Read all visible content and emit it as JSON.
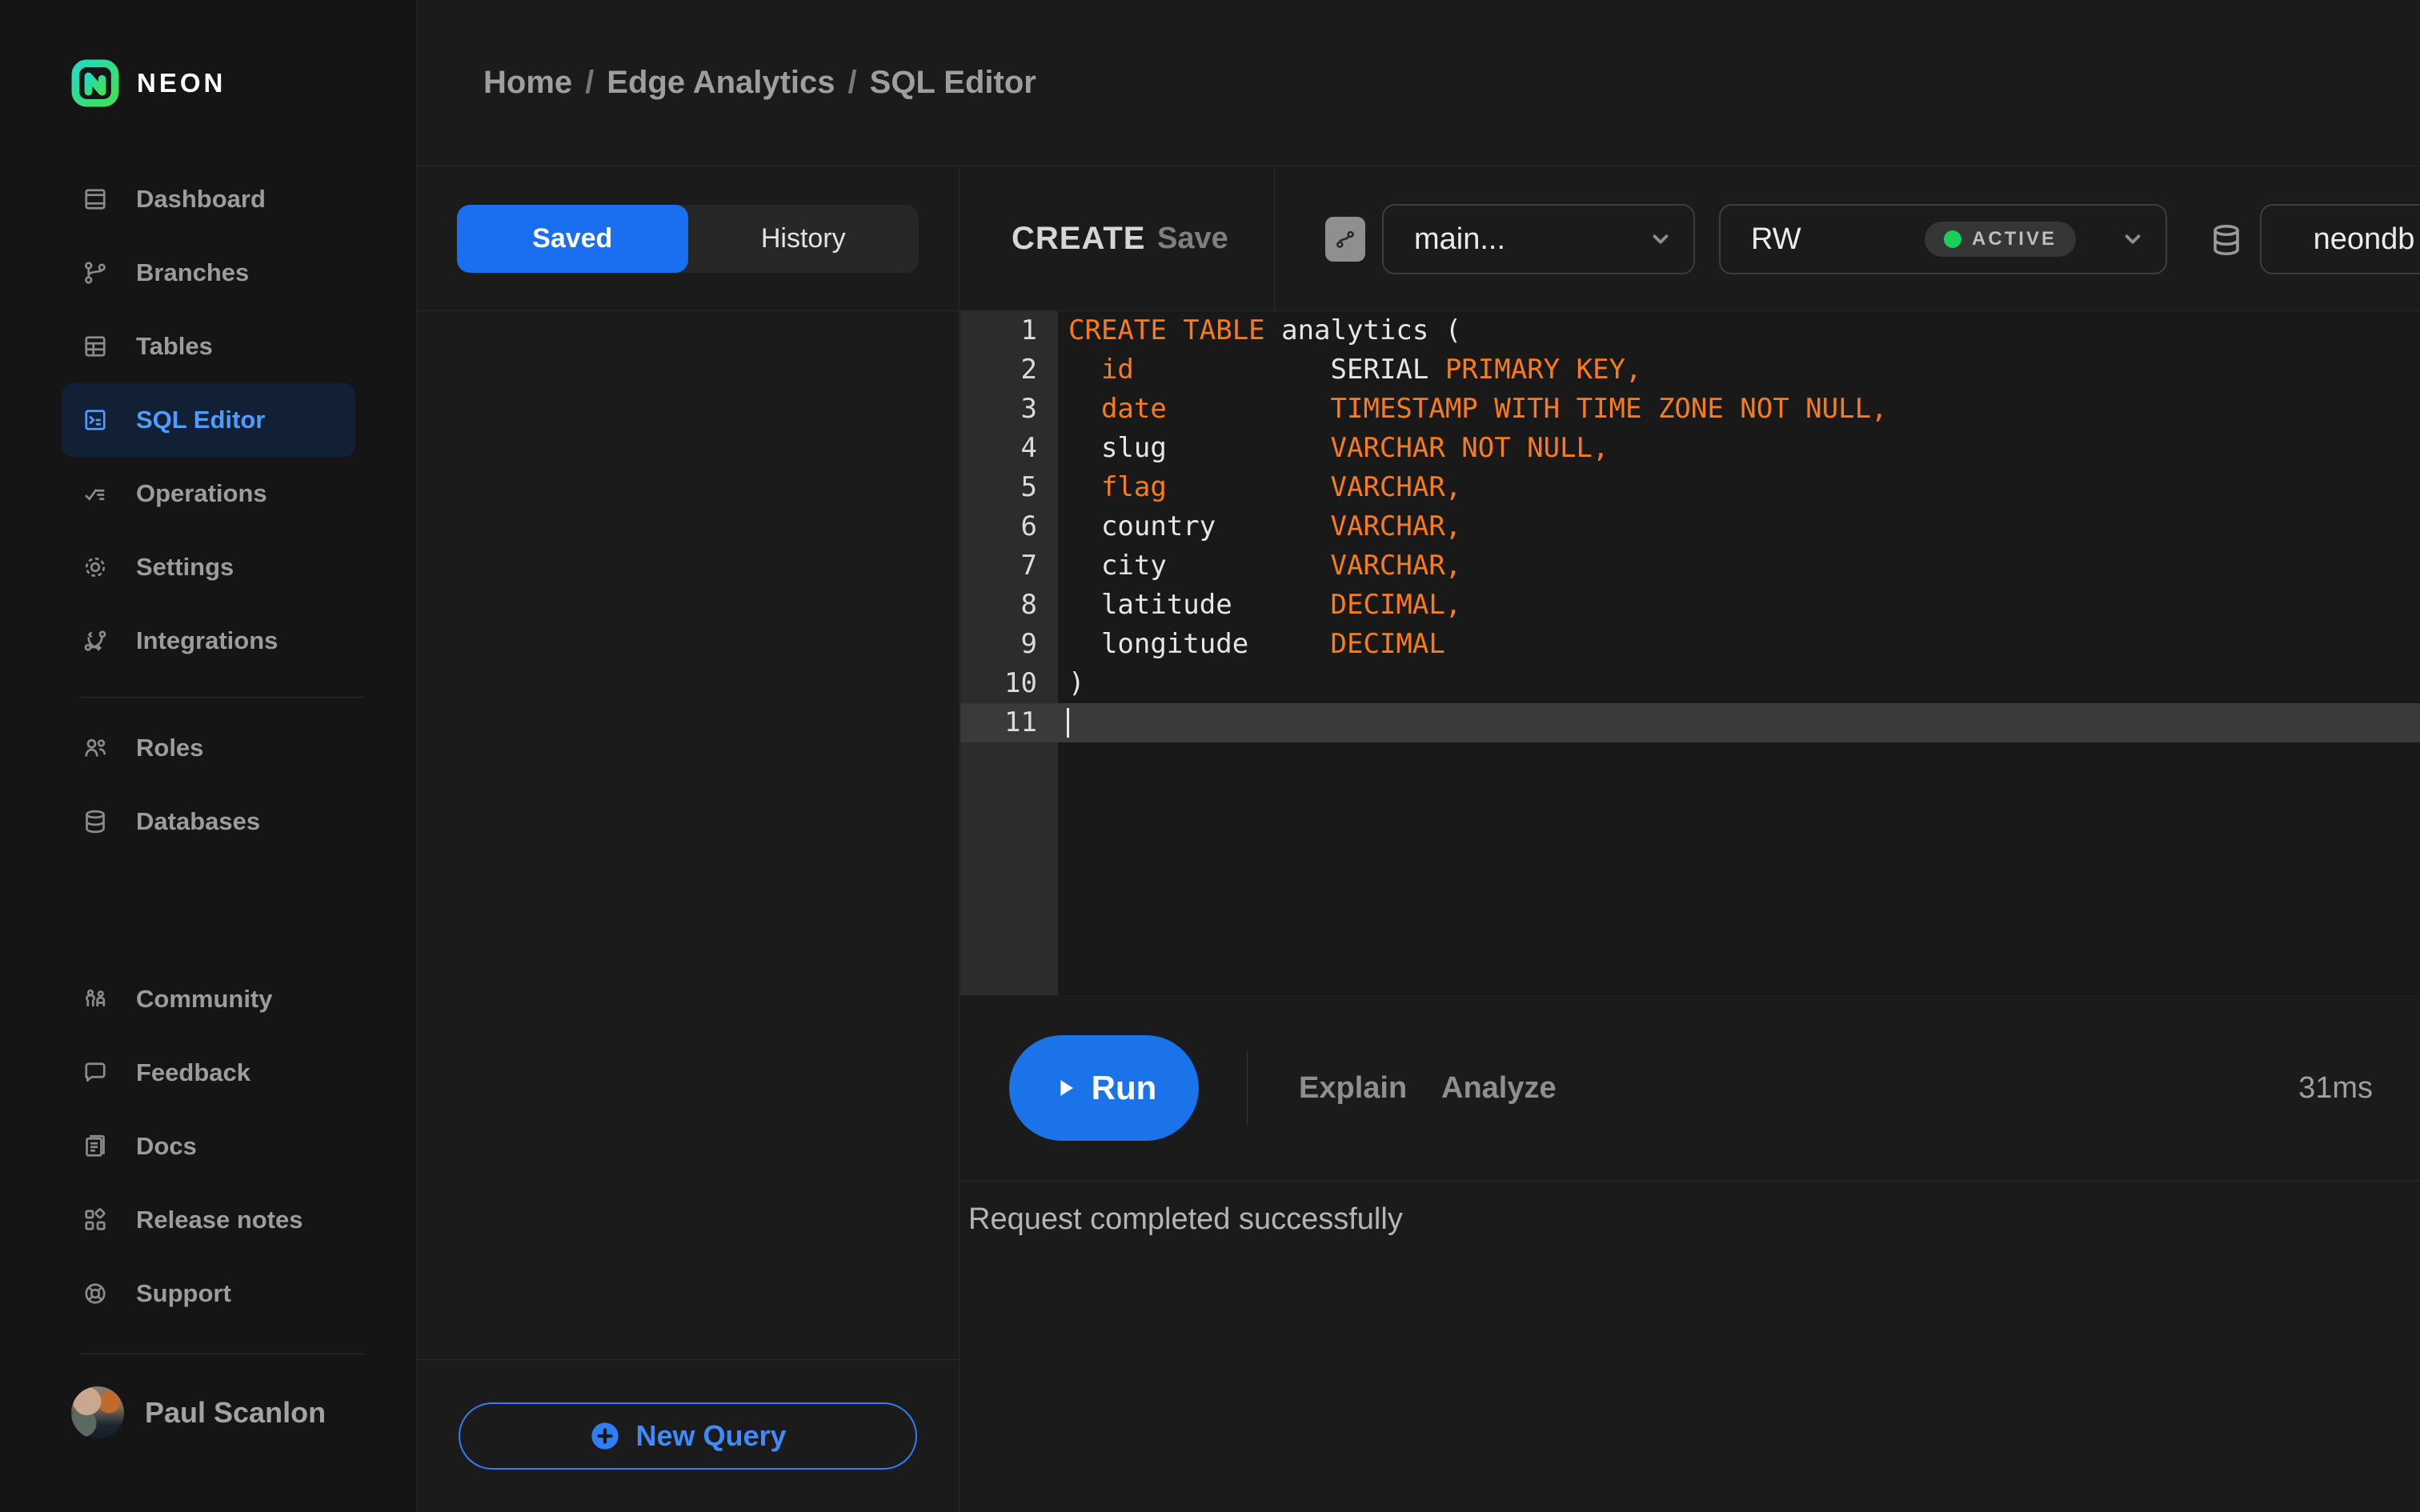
{
  "brand": {
    "name": "NEON"
  },
  "breadcrumb": {
    "separator": "/",
    "items": [
      {
        "label": "Home"
      },
      {
        "label": "Edge Analytics"
      },
      {
        "label": "SQL Editor"
      }
    ]
  },
  "sidebar": {
    "main_items": [
      {
        "label": "Dashboard"
      },
      {
        "label": "Branches"
      },
      {
        "label": "Tables"
      },
      {
        "label": "SQL Editor",
        "active": true
      },
      {
        "label": "Operations"
      },
      {
        "label": "Settings"
      },
      {
        "label": "Integrations"
      }
    ],
    "data_items": [
      {
        "label": "Roles"
      },
      {
        "label": "Databases"
      }
    ],
    "support_items": [
      {
        "label": "Community"
      },
      {
        "label": "Feedback"
      },
      {
        "label": "Docs"
      },
      {
        "label": "Release notes"
      },
      {
        "label": "Support"
      }
    ],
    "user": {
      "name": "Paul Scanlon"
    }
  },
  "query_panel": {
    "saved_tab": "Saved",
    "history_tab": "History",
    "new_query_label": "New Query"
  },
  "editor_toolbar": {
    "title": "CREATE",
    "save_label": "Save",
    "branch": "main...",
    "compute": "RW",
    "compute_status": "ACTIVE",
    "database": "neondb"
  },
  "code": {
    "active_line": 11,
    "lines": [
      {
        "n": "1",
        "tokens": [
          {
            "t": "CREATE TABLE",
            "c": "kw"
          },
          {
            "t": " analytics (",
            "c": "pl"
          }
        ]
      },
      {
        "n": "2",
        "tokens": [
          {
            "t": "  ",
            "c": "pl"
          },
          {
            "t": "id",
            "c": "kw"
          },
          {
            "t": "            SERIAL ",
            "c": "pl"
          },
          {
            "t": "PRIMARY KEY,",
            "c": "kw"
          }
        ]
      },
      {
        "n": "3",
        "tokens": [
          {
            "t": "  ",
            "c": "pl"
          },
          {
            "t": "date",
            "c": "kw"
          },
          {
            "t": "          ",
            "c": "pl"
          },
          {
            "t": "TIMESTAMP WITH TIME ZONE NOT NULL,",
            "c": "kw"
          }
        ]
      },
      {
        "n": "4",
        "tokens": [
          {
            "t": "  slug          ",
            "c": "pl"
          },
          {
            "t": "VARCHAR NOT NULL,",
            "c": "kw"
          }
        ]
      },
      {
        "n": "5",
        "tokens": [
          {
            "t": "  ",
            "c": "pl"
          },
          {
            "t": "flag",
            "c": "kw"
          },
          {
            "t": "          ",
            "c": "pl"
          },
          {
            "t": "VARCHAR,",
            "c": "kw"
          }
        ]
      },
      {
        "n": "6",
        "tokens": [
          {
            "t": "  country       ",
            "c": "pl"
          },
          {
            "t": "VARCHAR,",
            "c": "kw"
          }
        ]
      },
      {
        "n": "7",
        "tokens": [
          {
            "t": "  city          ",
            "c": "pl"
          },
          {
            "t": "VARCHAR,",
            "c": "kw"
          }
        ]
      },
      {
        "n": "8",
        "tokens": [
          {
            "t": "  latitude      ",
            "c": "pl"
          },
          {
            "t": "DECIMAL,",
            "c": "kw"
          }
        ]
      },
      {
        "n": "9",
        "tokens": [
          {
            "t": "  longitude     ",
            "c": "pl"
          },
          {
            "t": "DECIMAL",
            "c": "kw"
          }
        ]
      },
      {
        "n": "10",
        "tokens": [
          {
            "t": ")",
            "c": "pl"
          }
        ]
      },
      {
        "n": "11",
        "tokens": []
      }
    ]
  },
  "run_bar": {
    "run_label": "Run",
    "explain_label": "Explain",
    "analyze_label": "Analyze",
    "duration": "31ms"
  },
  "results": {
    "message": "Request completed successfully"
  },
  "colors": {
    "accent_blue": "#1a73e8",
    "saved_tab_blue": "#1a6ff0",
    "active_item_blue": "#4f9cff",
    "code_keyword_orange": "#f97c16",
    "status_green": "#17cf5a",
    "brand_gradient_teal": "#26d9c1",
    "brand_gradient_green": "#3fe154"
  }
}
